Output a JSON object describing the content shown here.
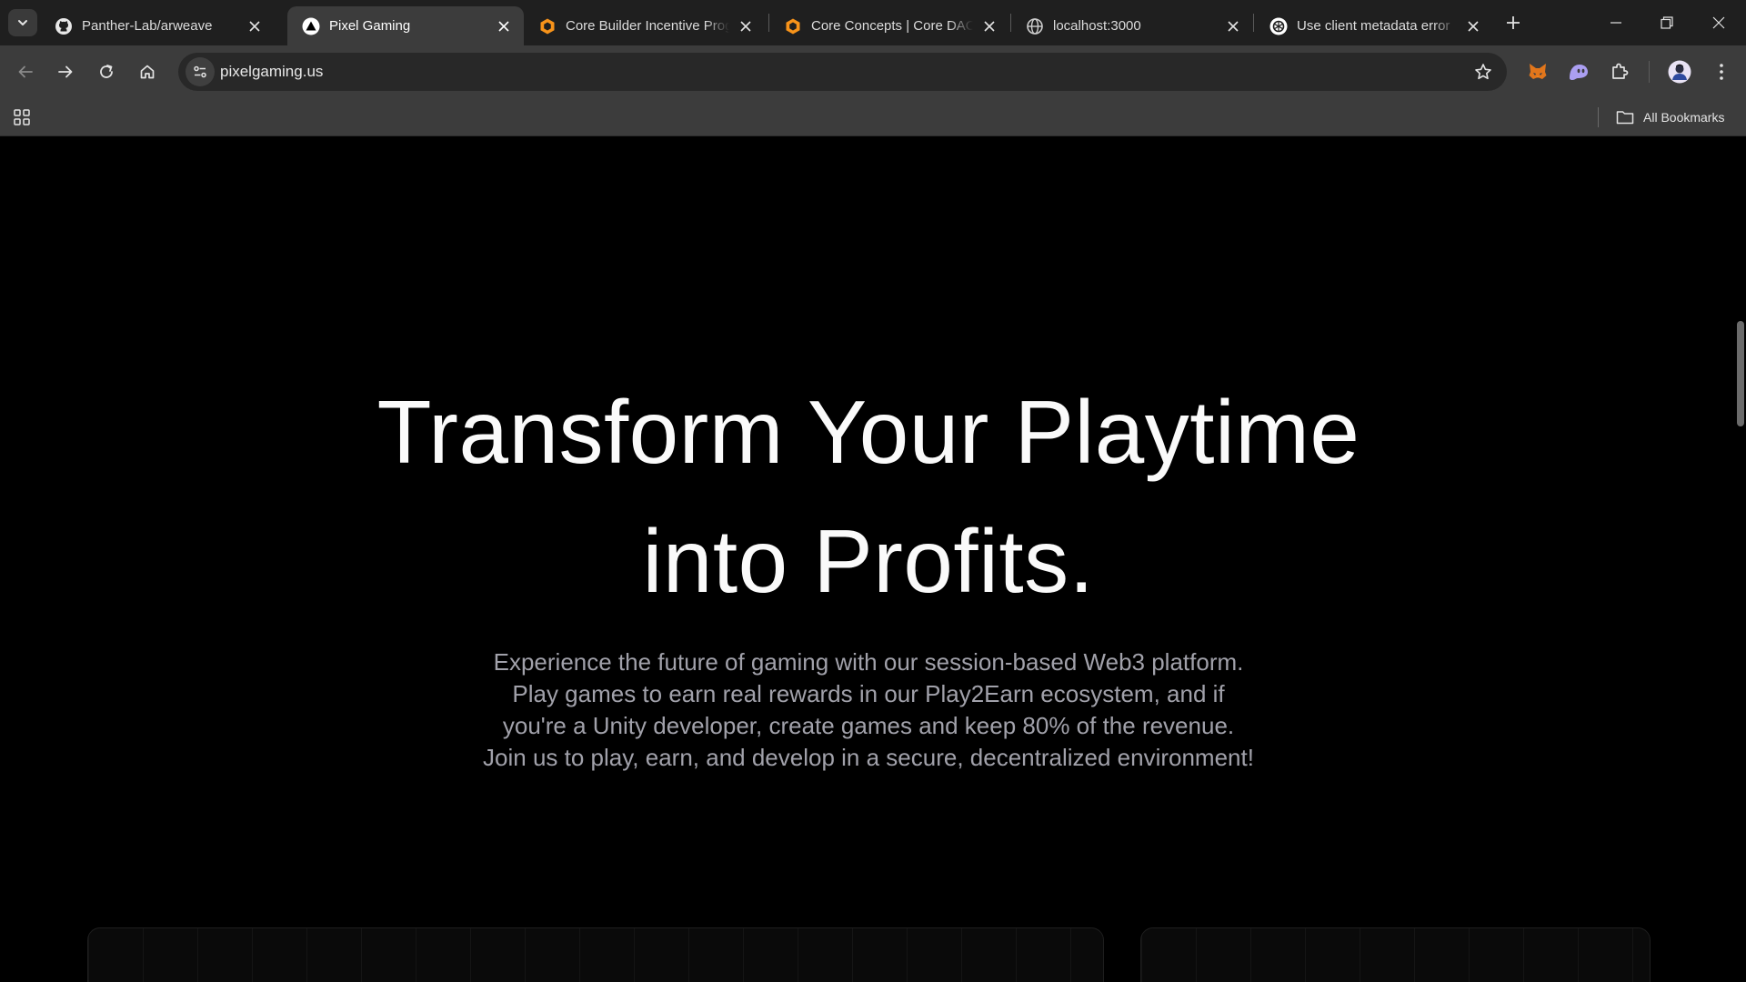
{
  "browser": {
    "tabs": [
      {
        "title": "Panther-Lab/arweave",
        "favicon": "github-icon",
        "active": false
      },
      {
        "title": "Pixel Gaming",
        "favicon": "triangle-logo-icon",
        "active": true
      },
      {
        "title": "Core Builder Incentive Program",
        "favicon": "core-dao-icon",
        "active": false
      },
      {
        "title": "Core Concepts | Core DAO",
        "favicon": "core-dao-icon",
        "active": false
      },
      {
        "title": "localhost:3000",
        "favicon": "globe-icon",
        "active": false
      },
      {
        "title": "Use client metadata error",
        "favicon": "openai-icon",
        "active": false
      }
    ],
    "address_bar": {
      "url": "pixelgaming.us"
    },
    "bookmarks_bar": {
      "all_bookmarks_label": "All Bookmarks"
    },
    "colors": {
      "tabstrip": "#1f1f1f",
      "toolbar": "#3c3c3c",
      "omnibox": "#282828",
      "core_orange": "#f7931a"
    }
  },
  "page": {
    "hero": {
      "title_line1": "Transform Your Playtime",
      "title_line2": "into Profits.",
      "description": "Experience the future of gaming with our session-based Web3 platform. Play games to earn real rewards in our Play2Earn ecosystem, and if you're a Unity developer, create games and keep 80% of the revenue. Join us to play, earn, and develop in a secure, decentralized environment!"
    },
    "colors": {
      "background": "#000000",
      "title": "#fafafa",
      "description": "#a1a1aa"
    }
  }
}
